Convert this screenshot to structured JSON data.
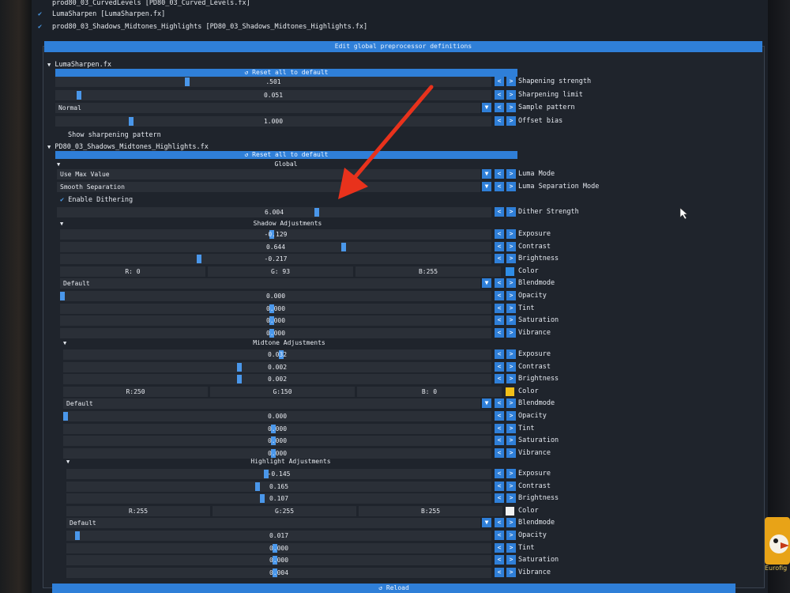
{
  "effects": [
    {
      "label": "prod80_03_CurvedLevels [PD80_03_Curved_Levels.fx]",
      "checked": false
    },
    {
      "label": "LumaSharpen [LumaSharpen.fx]",
      "checked": true
    },
    {
      "label": "prod80_03_Shadows_Midtones_Highlights [PD80_03_Shadows_Midtones_Highlights.fx]",
      "checked": true
    }
  ],
  "header": {
    "title": "Edit global preprocessor definitions"
  },
  "buttons": {
    "reset": "Reset all to default",
    "reload": "Reload",
    "dec": "<",
    "inc": ">",
    "drop": "▼"
  },
  "icons": {
    "check": "✔",
    "triangle": "▼",
    "reset": "↺"
  },
  "luma": {
    "name": "LumaSharpen.fx",
    "sharp_strength": {
      "value": ".501",
      "label": "Shapening strength",
      "frac": 0.3
    },
    "sharp_limit": {
      "value": "0.051",
      "label": "Sharpening limit",
      "frac": 0.05
    },
    "sample_pattern": {
      "value": "Normal",
      "label": "Sample pattern"
    },
    "offset_bias": {
      "value": "1.000",
      "label": "Offset bias",
      "frac": 0.17
    },
    "show_pattern": "Show sharpening pattern"
  },
  "pd80": {
    "name": "PD80_03_Shadows_Midtones_Highlights.fx",
    "global": {
      "title": "Global",
      "luma_mode": {
        "value": "Use Max Value",
        "label": "Luma Mode"
      },
      "luma_sep": {
        "value": "Smooth Separation",
        "label": "Luma Separation Mode"
      },
      "dithering": "Enable Dithering",
      "dither": {
        "value": "6.004",
        "label": "Dither Strength",
        "frac": 0.6
      }
    },
    "shadow": {
      "title": "Shadow Adjustments",
      "exposure": {
        "value": "-0.129",
        "label": "Exposure",
        "frac": 0.49
      },
      "contrast": {
        "value": "0.644",
        "label": "Contrast",
        "frac": 0.66
      },
      "brightness": {
        "value": "-0.217",
        "label": "Brightness",
        "frac": 0.32
      },
      "r": "R:  0",
      "g": "G: 93",
      "b": "B:255",
      "color_label": "Color",
      "swatch": "#2f8de6",
      "blend": {
        "value": "Default",
        "label": "Blendmode"
      },
      "opacity": {
        "value": "0.000",
        "label": "Opacity",
        "frac": 0.0
      },
      "tint": {
        "value": "0.000",
        "label": "Tint",
        "frac": 0.49
      },
      "saturation": {
        "value": "0.000",
        "label": "Saturation",
        "frac": 0.49
      },
      "vibrance": {
        "value": "0.000",
        "label": "Vibrance",
        "frac": 0.49
      }
    },
    "mid": {
      "title": "Midtone Adjustments",
      "exposure": {
        "value": "0.032",
        "label": "Exposure",
        "frac": 0.51
      },
      "contrast": {
        "value": "0.002",
        "label": "Contrast",
        "frac": 0.41
      },
      "brightness": {
        "value": "0.002",
        "label": "Brightness",
        "frac": 0.41
      },
      "r": "R:250",
      "g": "G:150",
      "b": "B:  0",
      "color_label": "Color",
      "swatch": "#f2c018",
      "blend": {
        "value": "Default",
        "label": "Blendmode"
      },
      "opacity": {
        "value": "0.000",
        "label": "Opacity",
        "frac": 0.0
      },
      "tint": {
        "value": "0.000",
        "label": "Tint",
        "frac": 0.49
      },
      "saturation": {
        "value": "0.000",
        "label": "Saturation",
        "frac": 0.49
      },
      "vibrance": {
        "value": "0.000",
        "label": "Vibrance",
        "frac": 0.49
      }
    },
    "high": {
      "title": "Highlight Adjustments",
      "exposure": {
        "value": "-0.145",
        "label": "Exposure",
        "frac": 0.47
      },
      "contrast": {
        "value": "0.165",
        "label": "Contrast",
        "frac": 0.45
      },
      "brightness": {
        "value": "0.107",
        "label": "Brightness",
        "frac": 0.46
      },
      "r": "R:255",
      "g": "G:255",
      "b": "B:255",
      "color_label": "Color",
      "swatch": "#f2f2f2",
      "blend": {
        "value": "Default",
        "label": "Blendmode"
      },
      "opacity": {
        "value": "0.017",
        "label": "Opacity",
        "frac": 0.02
      },
      "tint": {
        "value": "0.000",
        "label": "Tint",
        "frac": 0.49
      },
      "saturation": {
        "value": "0.000",
        "label": "Saturation",
        "frac": 0.49
      },
      "vibrance": {
        "value": "0.004",
        "label": "Vibrance",
        "frac": 0.49
      }
    }
  },
  "taskbar": {
    "app_label": "Eurofig"
  }
}
